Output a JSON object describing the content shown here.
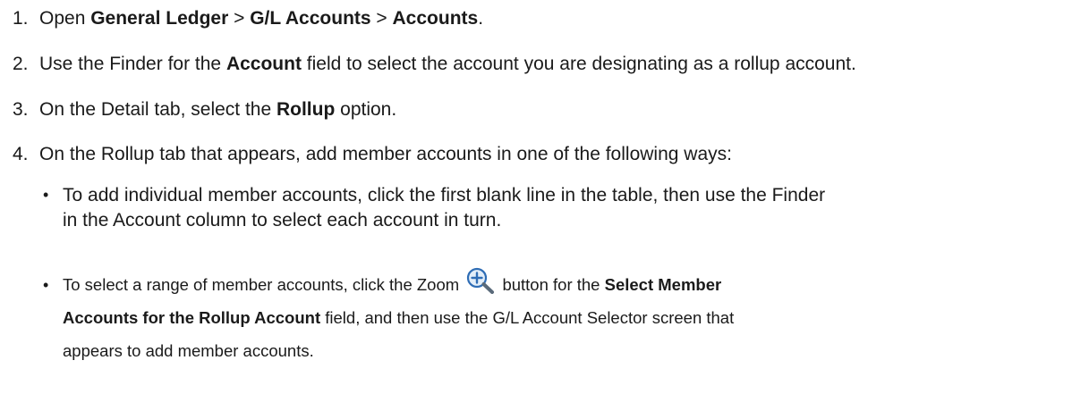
{
  "steps": [
    {
      "number": "1.",
      "parts": [
        {
          "text": "Open ",
          "bold": false
        },
        {
          "text": "General Ledger",
          "bold": true
        },
        {
          "text": " > ",
          "bold": false
        },
        {
          "text": "G/L Accounts",
          "bold": true
        },
        {
          "text": " > ",
          "bold": false
        },
        {
          "text": "Accounts",
          "bold": true
        },
        {
          "text": ".",
          "bold": false
        }
      ]
    },
    {
      "number": "2.",
      "parts": [
        {
          "text": "Use the Finder for the ",
          "bold": false
        },
        {
          "text": "Account",
          "bold": true
        },
        {
          "text": " field to select the account you are designating as a rollup account.",
          "bold": false
        }
      ]
    },
    {
      "number": "3.",
      "parts": [
        {
          "text": "On the Detail tab, select the ",
          "bold": false
        },
        {
          "text": "Rollup",
          "bold": true
        },
        {
          "text": " option.",
          "bold": false
        }
      ]
    },
    {
      "number": "4.",
      "parts": [
        {
          "text": "On the Rollup tab that appears, add member accounts in one of the following ways:",
          "bold": false
        }
      ]
    }
  ],
  "bullets": {
    "first": {
      "marker": "•",
      "line1": "To add individual member accounts, click the first blank line in the table, then use the Finder",
      "line2": "in the Account column to select each account in turn."
    },
    "second": {
      "marker": "•",
      "line1_before": "To select a range of member accounts, click the Zoom ",
      "line1_after": " button for the ",
      "line1_bold": "Select Member",
      "line2_bold": "Accounts for the Rollup Account",
      "line2_after": " field, and then use the G/L Account Selector screen that",
      "line3": "appears to add member accounts."
    }
  },
  "icons": {
    "zoom": "zoom-in-icon"
  },
  "colors": {
    "zoom_icon_stroke": "#2f6db5",
    "zoom_icon_fill": "#e3eef9",
    "zoom_handle": "#5a6a7a"
  }
}
